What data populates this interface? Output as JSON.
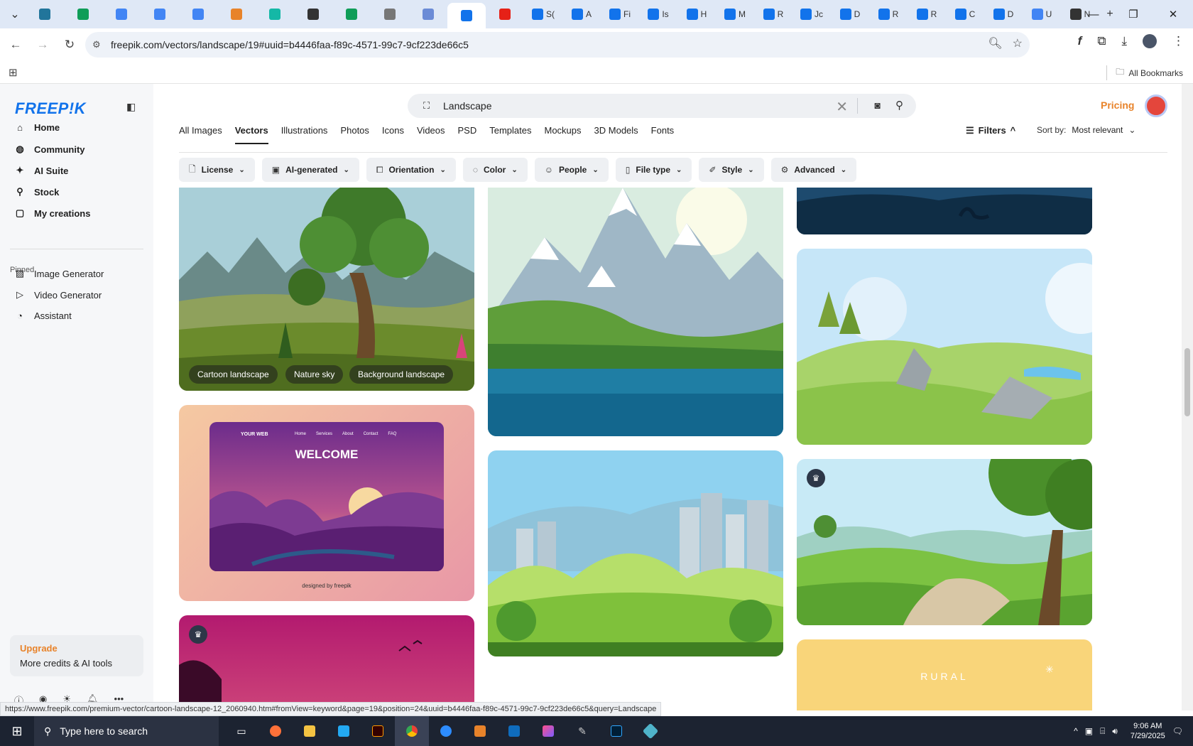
{
  "browser": {
    "tabs": [
      {
        "icon": "wordpress-icon",
        "label": "",
        "color": "#21759b"
      },
      {
        "icon": "sheets-icon",
        "label": "",
        "color": "#0f9d58"
      },
      {
        "icon": "docs-icon",
        "label": "",
        "color": "#4285f4"
      },
      {
        "icon": "docs-icon",
        "label": "",
        "color": "#4285f4"
      },
      {
        "icon": "docs-icon",
        "label": "",
        "color": "#4285f4"
      },
      {
        "icon": "html-icon",
        "label": "",
        "color": "#e8832a"
      },
      {
        "icon": "app-icon",
        "label": "",
        "color": "#14b8a6"
      },
      {
        "icon": "openai-icon",
        "label": "",
        "color": "#333333"
      },
      {
        "icon": "sheets-icon",
        "label": "",
        "color": "#0f9d58"
      },
      {
        "icon": "globe-icon",
        "label": "",
        "color": "#777777"
      },
      {
        "icon": "grid-icon",
        "label": "",
        "color": "#6b8bd6"
      },
      {
        "icon": "freepik-icon",
        "label": "",
        "color": "#1273eb",
        "active": true
      },
      {
        "icon": "youtube-icon",
        "label": "",
        "color": "#e62117"
      },
      {
        "icon": "freepik-icon",
        "label": "S(",
        "color": "#1273eb"
      },
      {
        "icon": "freepik-icon",
        "label": "A",
        "color": "#1273eb"
      },
      {
        "icon": "freepik-icon",
        "label": "Fi",
        "color": "#1273eb"
      },
      {
        "icon": "freepik-icon",
        "label": "Is",
        "color": "#1273eb"
      },
      {
        "icon": "freepik-icon",
        "label": "H",
        "color": "#1273eb"
      },
      {
        "icon": "freepik-icon",
        "label": "M",
        "color": "#1273eb"
      },
      {
        "icon": "freepik-icon",
        "label": "R",
        "color": "#1273eb"
      },
      {
        "icon": "freepik-icon",
        "label": "Jc",
        "color": "#1273eb"
      },
      {
        "icon": "freepik-icon",
        "label": "D",
        "color": "#1273eb"
      },
      {
        "icon": "freepik-icon",
        "label": "R",
        "color": "#1273eb"
      },
      {
        "icon": "freepik-icon",
        "label": "R",
        "color": "#1273eb"
      },
      {
        "icon": "freepik-icon",
        "label": "C",
        "color": "#1273eb"
      },
      {
        "icon": "freepik-icon",
        "label": "D",
        "color": "#1273eb"
      },
      {
        "icon": "google-icon",
        "label": "U",
        "color": "#4285f4"
      },
      {
        "icon": "openai-icon",
        "label": "N",
        "color": "#333333"
      }
    ],
    "url": "freepik.com/vectors/landscape/19#uuid=b4446faa-f89c-4571-99c7-9cf223de66c5",
    "all_bookmarks": "All Bookmarks",
    "status_url": "https://www.freepik.com/premium-vector/cartoon-landscape-12_2060940.htm#fromView=keyword&page=19&position=24&uuid=b4446faa-f89c-4571-99c7-9cf223de66c5&query=Landscape"
  },
  "sidebar": {
    "logo": "FREEP!K",
    "nav": [
      {
        "icon": "home-icon",
        "label": "Home"
      },
      {
        "icon": "globe-icon",
        "label": "Community"
      },
      {
        "icon": "sparkle-icon",
        "label": "AI Suite"
      },
      {
        "icon": "search-icon",
        "label": "Stock"
      },
      {
        "icon": "folder-icon",
        "label": "My creations"
      }
    ],
    "pinned_label": "Pinned",
    "pinned": [
      {
        "icon": "image-icon",
        "label": "Image Generator"
      },
      {
        "icon": "video-icon",
        "label": "Video Generator"
      },
      {
        "icon": "assistant-icon",
        "label": "Assistant"
      }
    ],
    "upgrade_title": "Upgrade",
    "upgrade_sub": "More credits & AI tools"
  },
  "header": {
    "search_value": "Landscape",
    "pricing": "Pricing"
  },
  "categories": [
    "All Images",
    "Vectors",
    "Illustrations",
    "Photos",
    "Icons",
    "Videos",
    "PSD",
    "Templates",
    "Mockups",
    "3D Models",
    "Fonts"
  ],
  "active_category": "Vectors",
  "filters_label": "Filters",
  "sort_label": "Sort by:",
  "sort_value": "Most relevant",
  "chips": [
    {
      "icon": "license-icon",
      "label": "License"
    },
    {
      "icon": "ai-icon",
      "label": "AI-generated"
    },
    {
      "icon": "orientation-icon",
      "label": "Orientation"
    },
    {
      "icon": "color-icon",
      "label": "Color"
    },
    {
      "icon": "people-icon",
      "label": "People"
    },
    {
      "icon": "file-icon",
      "label": "File type"
    },
    {
      "icon": "brush-icon",
      "label": "Style"
    },
    {
      "icon": "gear-icon",
      "label": "Advanced"
    }
  ],
  "cards": {
    "card1_tags": [
      "Cartoon landscape",
      "Nature sky",
      "Background landscape"
    ],
    "mockup": {
      "brand": "YOUR WEB",
      "nav": [
        "Home",
        "Services",
        "About",
        "Contact",
        "FAQ"
      ],
      "headline": "WELCOME",
      "credit": "designed by  freepik"
    },
    "rural_text": "RURAL"
  },
  "taskbar": {
    "search_placeholder": "Type here to search",
    "time": "9:06 AM",
    "date": "7/29/2025"
  }
}
